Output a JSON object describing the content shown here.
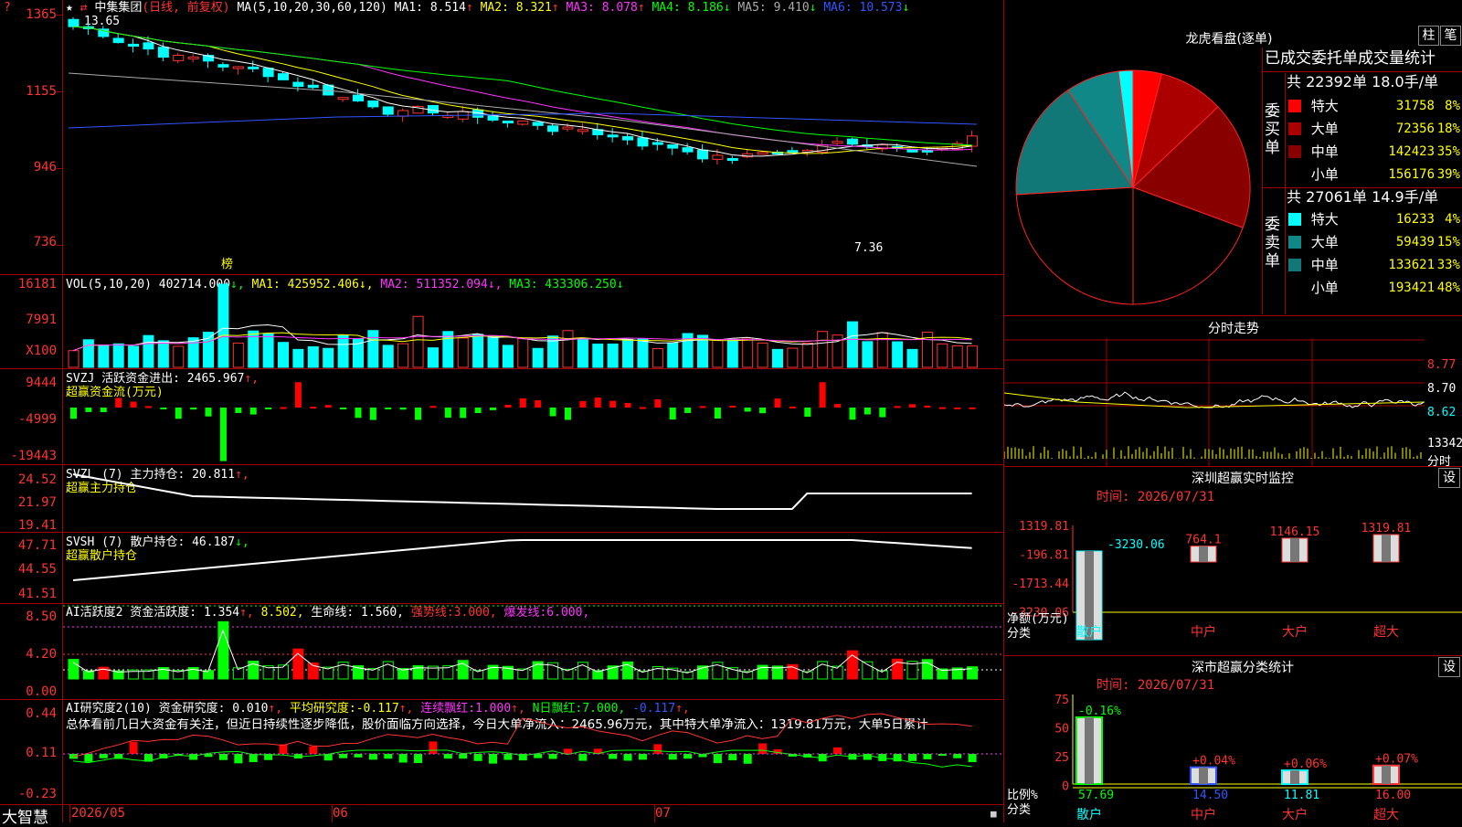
{
  "stock_name": "中集集团",
  "period": "(日线, 前复权)",
  "ma_header": {
    "label": "MA(5,10,20,30,60,120)",
    "items": [
      {
        "name": "MA1",
        "value": "8.514",
        "arrow": "↑",
        "color": "#ffffff"
      },
      {
        "name": "MA2",
        "value": "8.321",
        "arrow": "↑",
        "color": "#ffff00"
      },
      {
        "name": "MA3",
        "value": "8.078",
        "arrow": "↑",
        "color": "#ff33ff"
      },
      {
        "name": "MA4",
        "value": "8.186",
        "arrow": "↓",
        "color": "#00ff00"
      },
      {
        "name": "MA5",
        "value": "9.410",
        "arrow": "↓",
        "color": "#aaaaaa"
      },
      {
        "name": "MA6",
        "value": "10.573",
        "arrow": "↓",
        "color": "#3355ff"
      }
    ]
  },
  "price_axis": [
    "1365",
    "1155",
    "946",
    "736"
  ],
  "price_marks": {
    "high": "13.65",
    "low": "7.36",
    "bang": "榜"
  },
  "vol_header": {
    "label": "VOL(5,10,20)",
    "value": "402714.000",
    "ma1": "MA1: 425952.406",
    "ma2": "MA2: 511352.094",
    "ma3": "MA3: 433306.250"
  },
  "vol_axis": [
    "16181",
    "7991",
    "X100"
  ],
  "svzj_header": {
    "label": "SVZJ  活跃资金进出:",
    "value": "2465.967",
    "arrow": "↑,",
    "sub": "超赢资金流(万元)"
  },
  "svzj_axis": [
    "9444",
    "-4999",
    "-19443"
  ],
  "svzl_header": {
    "label": "SVZL (7) 主力持仓:",
    "value": "20.811",
    "arrow": "↑,",
    "sub": "超赢主力持仓"
  },
  "svzl_axis": [
    "24.52",
    "21.97",
    "19.41"
  ],
  "svsh_header": {
    "label": "SVSH (7) 散户持仓:",
    "value": "46.187",
    "arrow": "↓,",
    "sub": "超赢散户持仓"
  },
  "svsh_axis": [
    "47.71",
    "44.55",
    "41.51"
  ],
  "ai1_header": {
    "label": "AI活跃度2 资金活跃度:",
    "v1": "1.354",
    "a1": "↑,",
    "v2": "8.502,",
    "l3": "生命线:",
    "v3": "1.560,",
    "l4": "强势线:",
    "v4": "3.000,",
    "l5": "爆发线:",
    "v5": "6.000,"
  },
  "ai1_axis": [
    "8.50",
    "4.20",
    "0.00"
  ],
  "ai2_header": {
    "label": "AI研究度2(10) 资金研究度:",
    "v1": "0.010",
    "a1": "↑,",
    "l2": "平均研究度:",
    "v2": "-0.117",
    "a2": "↑,",
    "l3": "连续飘红:",
    "v3": "1.000",
    "a3": "↑,",
    "l4": "N日飘红:",
    "v4": "7.000,",
    "v5": "-0.117",
    "a5": "↑,"
  },
  "ai2_text": "总体看前几日大资金有关注，但近日持续性逐步降低，股价面临方向选择，今日大单净流入：2465.96万元，其中特大单净流入：1319.81万元，大单5日累计",
  "ai2_axis": [
    "0.44",
    "0.11",
    "-0.23"
  ],
  "bottom": {
    "brand": "大智慧",
    "dates": [
      "2026/05",
      "06",
      "07"
    ]
  },
  "right": {
    "lhb_title": "龙虎看盘(逐单)",
    "btn_zhu": "柱",
    "btn_bi": "笔",
    "stat_title": "已成交委托单成交量统计",
    "buy": {
      "summary": "共 22392单 18.0手/单",
      "label": "委买单",
      "rows": [
        {
          "name": "特大",
          "value": "31758",
          "pct": "8%",
          "color": "#ff0000"
        },
        {
          "name": "大单",
          "value": "72356",
          "pct": "18%",
          "color": "#aa0000"
        },
        {
          "name": "中单",
          "value": "142423",
          "pct": "35%",
          "color": "#880000"
        },
        {
          "name": "小单",
          "value": "156176",
          "pct": "39%",
          "color": "#000000"
        }
      ]
    },
    "sell": {
      "summary": "共 27061单 14.9手/单",
      "label": "委卖单",
      "rows": [
        {
          "name": "特大",
          "value": "16233",
          "pct": "4%",
          "color": "#00ffff"
        },
        {
          "name": "大单",
          "value": "59439",
          "pct": "15%",
          "color": "#118888"
        },
        {
          "name": "中单",
          "value": "133621",
          "pct": "33%",
          "color": "#117777"
        },
        {
          "name": "小单",
          "value": "193421",
          "pct": "48%",
          "color": "#000000"
        }
      ]
    },
    "fenshi_title": "分时走势",
    "fenshi_axis": [
      "8.77",
      "8.70",
      "8.62",
      "13342",
      "分时"
    ],
    "monitor": {
      "title": "深圳超赢实时监控",
      "time": "时间: 2026/07/31",
      "btn": "设",
      "axis": [
        "1319.81",
        "-196.81",
        "-1713.44",
        "-3230.06"
      ],
      "bars": [
        {
          "cat": "散户",
          "value": -3230.06,
          "label": "-3230.06"
        },
        {
          "cat": "中户",
          "value": 764.1,
          "label": "764.1"
        },
        {
          "cat": "大户",
          "value": 1146.15,
          "label": "1146.15"
        },
        {
          "cat": "超大",
          "value": 1319.81,
          "label": "1319.81"
        }
      ],
      "ylabel1": "净额(万元)",
      "ylabel2": "分类"
    },
    "classify": {
      "title": "深市超赢分类统计",
      "time": "时间: 2026/07/31",
      "btn": "设",
      "axis": [
        "75",
        "50",
        "25",
        "0"
      ],
      "bars": [
        {
          "cat": "散户",
          "value": 57.69,
          "label": "57.69",
          "change": "-0.16%",
          "color": "#00ff00"
        },
        {
          "cat": "中户",
          "value": 14.5,
          "label": "14.50",
          "change": "+0.04%",
          "color": "#3355ff"
        },
        {
          "cat": "大户",
          "value": 11.81,
          "label": "11.81",
          "change": "+0.06%",
          "color": "#00ffff"
        },
        {
          "cat": "超大",
          "value": 16.0,
          "label": "16.00",
          "change": "+0.07%",
          "color": "#ff3333"
        }
      ],
      "ylabel1": "比例%",
      "ylabel2": "分类"
    }
  },
  "chart_data": [
    {
      "type": "pie",
      "title": "龙虎看盘(逐单)",
      "categories": [
        "委买特大",
        "委买大单",
        "委买中单",
        "委买小单",
        "委卖小单",
        "委卖中单",
        "委卖大单",
        "委卖特大"
      ],
      "values": [
        31758,
        72356,
        142423,
        156176,
        193421,
        133621,
        59439,
        16233
      ]
    },
    {
      "type": "bar",
      "title": "深圳超赢实时监控",
      "categories": [
        "散户",
        "中户",
        "大户",
        "超大"
      ],
      "values": [
        -3230.06,
        764.1,
        1146.15,
        1319.81
      ],
      "ylabel": "净额(万元)",
      "ylim": [
        -3230.06,
        1319.81
      ]
    },
    {
      "type": "bar",
      "title": "深市超赢分类统计",
      "categories": [
        "散户",
        "中户",
        "大户",
        "超大"
      ],
      "values": [
        57.69,
        14.5,
        11.81,
        16.0
      ],
      "ylabel": "比例%",
      "ylim": [
        0,
        75
      ]
    }
  ]
}
